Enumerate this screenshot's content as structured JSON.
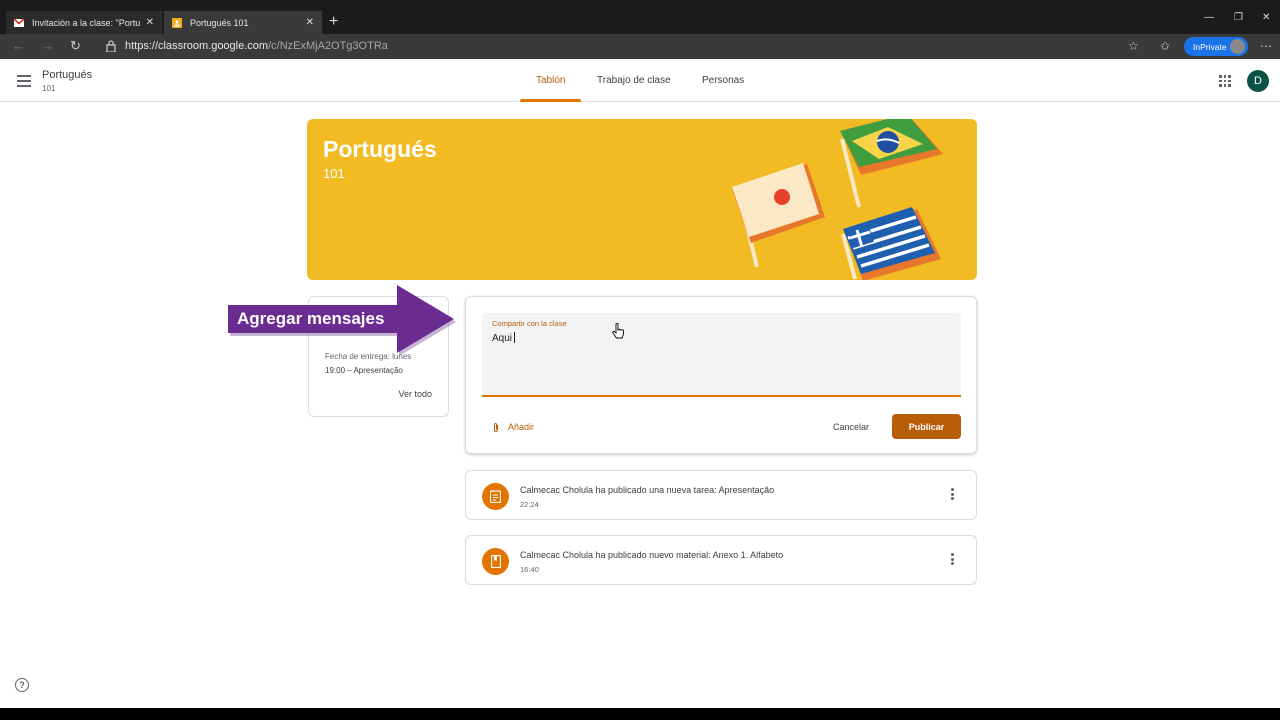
{
  "browser": {
    "tabs": [
      {
        "label": "Invitación a la clase: \"Portugués",
        "icon": "gmail-icon",
        "active": false
      },
      {
        "label": "Portugués 101",
        "icon": "classroom-icon",
        "active": true
      }
    ],
    "url_main": "https://classroom.google.com",
    "url_path": "/c/NzExMjA2OTg3OTRa",
    "inprivate_label": "InPrivate"
  },
  "header": {
    "class_name": "Portugués",
    "section": "101",
    "tabs": [
      "Tablón",
      "Trabajo de clase",
      "Personas"
    ],
    "active_tab": 0,
    "avatar_letter": "D"
  },
  "banner": {
    "title": "Portugués",
    "subtitle": "101",
    "color": "#f3bb23"
  },
  "upcoming": {
    "due_line": "Fecha de entrega: lunes",
    "task_line": "19:00 – Apresentação",
    "view_all": "Ver todo"
  },
  "annotation": {
    "label": "Agregar mensajes",
    "color": "#6a2c91"
  },
  "composer": {
    "label": "Compartir con la clase",
    "value": "Aqui",
    "add_label": "Añadir",
    "cancel_label": "Cancelar",
    "publish_label": "Publicar",
    "accent": "#b85d08"
  },
  "stream": [
    {
      "text": "Calmecac Cholula ha publicado una nueva tarea: Apresentação",
      "time": "22:24",
      "icon": "assignment-icon"
    },
    {
      "text": "Calmecac Cholula ha publicado nuevo material: Anexo 1. Alfabeto",
      "time": "16:40",
      "icon": "material-icon"
    }
  ]
}
